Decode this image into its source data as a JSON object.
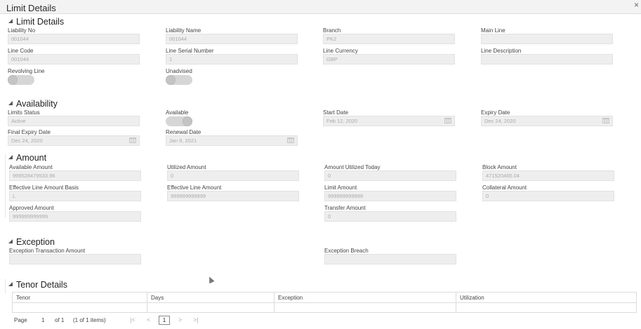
{
  "window": {
    "title": "Limit Details",
    "close_glyph": "×"
  },
  "sections": {
    "limit_details": "Limit Details",
    "availability": "Availability",
    "amount": "Amount",
    "exception": "Exception",
    "tenor_details": "Tenor Details"
  },
  "limit": {
    "liability_no": {
      "label": "Liability No",
      "value": "001044"
    },
    "liability_name": {
      "label": "Liability Name",
      "value": "001044"
    },
    "branch": {
      "label": "Branch",
      "value": "PK2"
    },
    "main_line": {
      "label": "Main Line",
      "value": ""
    },
    "line_code": {
      "label": "Line Code",
      "value": "001044"
    },
    "line_serial": {
      "label": "Line Serial Number",
      "value": "1"
    },
    "line_currency": {
      "label": "Line Currency",
      "value": "GBP"
    },
    "line_description": {
      "label": "Line Description",
      "value": ""
    },
    "revolving_line": {
      "label": "Revolving Line"
    },
    "unadvised": {
      "label": "Unadvised"
    }
  },
  "availability": {
    "limits_status": {
      "label": "Limits Status",
      "value": "Active"
    },
    "available": {
      "label": "Available"
    },
    "start_date": {
      "label": "Start Date",
      "value": "Feb 12, 2020"
    },
    "expiry_date": {
      "label": "Expiry Date",
      "value": "Dec 24, 2020"
    },
    "final_expiry_date": {
      "label": "Final Expiry Date",
      "value": "Dec 24, 2020"
    },
    "renewal_date": {
      "label": "Renewal Date",
      "value": "Jan 9, 2021"
    }
  },
  "amount": {
    "available_amount": {
      "label": "Available Amount",
      "value": "999528479533.96"
    },
    "utilized_amount": {
      "label": "Utilized Amount",
      "value": "0"
    },
    "amount_utilized_today": {
      "label": "Amount Utilized Today",
      "value": "0"
    },
    "block_amount": {
      "label": "Block Amount",
      "value": "471520465.04"
    },
    "effective_line_amount_basis": {
      "label": "Effective Line Amount Basis",
      "value": "L"
    },
    "effective_line_amount": {
      "label": "Effective Line Amount",
      "value": "999999999999"
    },
    "limit_amount": {
      "label": "Limit Amount",
      "value": "999999999999"
    },
    "collateral_amount": {
      "label": "Collateral Amount",
      "value": "0"
    },
    "approved_amount": {
      "label": "Approved Amount",
      "value": "999999999999"
    },
    "transfer_amount": {
      "label": "Transfer Amount",
      "value": "0"
    }
  },
  "exception": {
    "transaction_amount": {
      "label": "Exception Transaction Amount",
      "value": ""
    },
    "breach": {
      "label": "Exception Breach",
      "value": ""
    }
  },
  "tenor": {
    "columns": [
      "Tenor",
      "Days",
      "Exception",
      "Utilization"
    ]
  },
  "pager": {
    "page_label": "Page",
    "page_value": "1",
    "of_label": "of 1",
    "items_label": "(1 of 1 items)",
    "first": "|<",
    "prev": "<",
    "current": "1",
    "next": ">",
    "last": ">|"
  }
}
